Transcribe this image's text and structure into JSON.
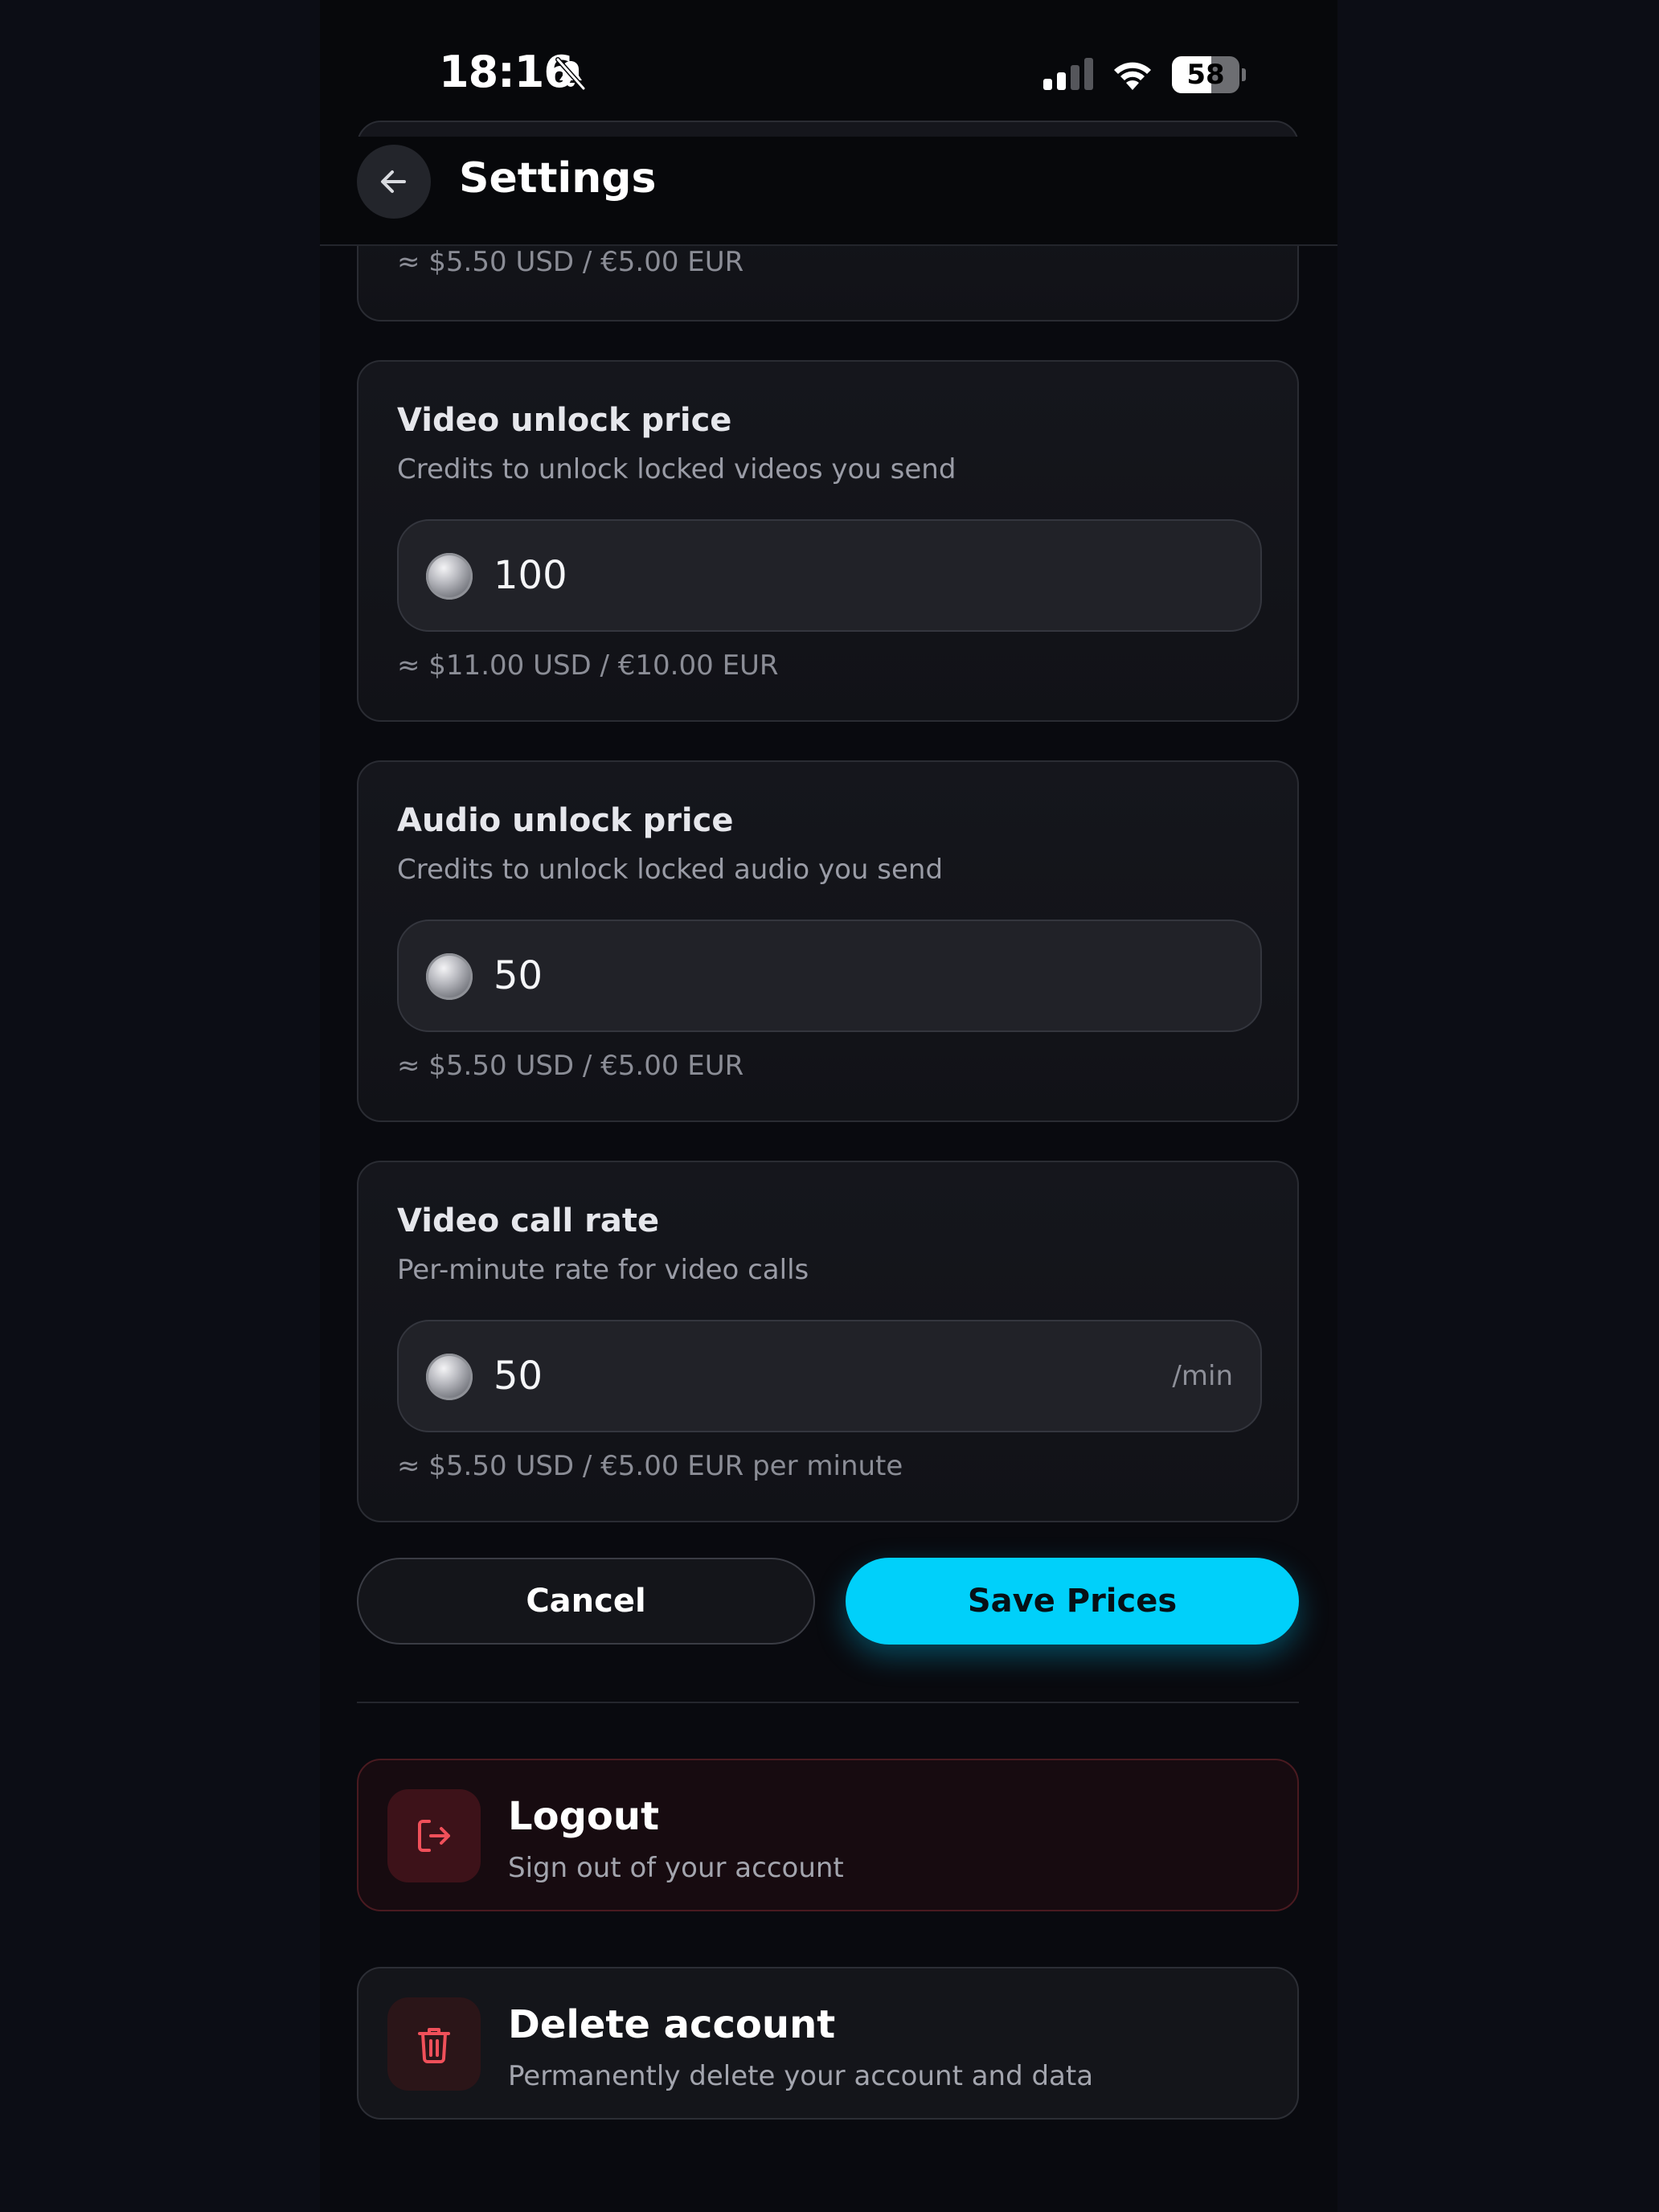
{
  "status_bar": {
    "time": "18:16",
    "battery": 58,
    "battery_label": "58"
  },
  "header": {
    "title": "Settings"
  },
  "previous_card": {
    "approx": "≈ $5.50 USD / €5.00 EUR"
  },
  "prices": [
    {
      "title": "Video unlock price",
      "description": "Credits to unlock locked videos you send",
      "value": "100",
      "suffix": "",
      "approx": "≈ $11.00 USD / €10.00 EUR"
    },
    {
      "title": "Audio unlock price",
      "description": "Credits to unlock locked audio you send",
      "value": "50",
      "suffix": "",
      "approx": "≈ $5.50 USD / €5.00 EUR"
    },
    {
      "title": "Video call rate",
      "description": "Per-minute rate for video calls",
      "value": "50",
      "suffix": "/min",
      "approx": "≈ $5.50 USD / €5.00 EUR per minute"
    }
  ],
  "actions": {
    "cancel_label": "Cancel",
    "save_label": "Save Prices"
  },
  "account": {
    "logout_title": "Logout",
    "logout_sub": "Sign out of your account",
    "delete_title": "Delete account",
    "delete_sub": "Permanently delete your account and data"
  },
  "colors": {
    "accent": "#00d0fa",
    "danger": "#f0505a",
    "background": "#090a0f"
  },
  "icons": {
    "back": "arrow-left-icon",
    "bell": "bell-slash-icon",
    "coin": "coin-icon",
    "logout": "logout-icon",
    "delete": "trash-icon"
  }
}
